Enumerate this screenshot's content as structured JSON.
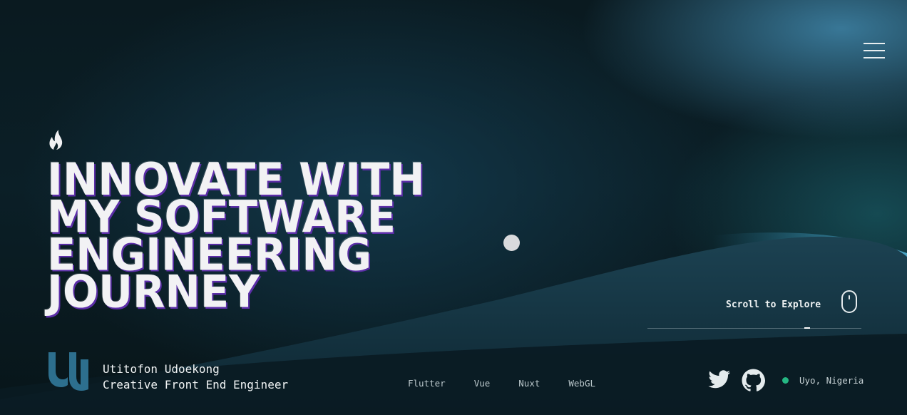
{
  "hero": {
    "headline_lines": [
      "INNOVATE WITH",
      "MY SOFTWARE",
      "ENGINEERING",
      "JOURNEY"
    ]
  },
  "scroll": {
    "label": "Scroll to Explore",
    "progress": 0.74
  },
  "profile": {
    "name": "Utitofon Udoekong",
    "role": "Creative Front End Engineer",
    "logo_icon": "uu-monogram-logo"
  },
  "tech": [
    "Flutter",
    "Vue",
    "Nuxt",
    "WebGL"
  ],
  "social": {
    "twitter_icon": "twitter-icon",
    "github_icon": "github-icon"
  },
  "status": {
    "location": "Uyo, Nigeria",
    "dot_color": "#25b783"
  },
  "colors": {
    "accent_shadow": "#5c2ea8",
    "logo": "#2d6f8e",
    "text": "#f2f2f4"
  }
}
